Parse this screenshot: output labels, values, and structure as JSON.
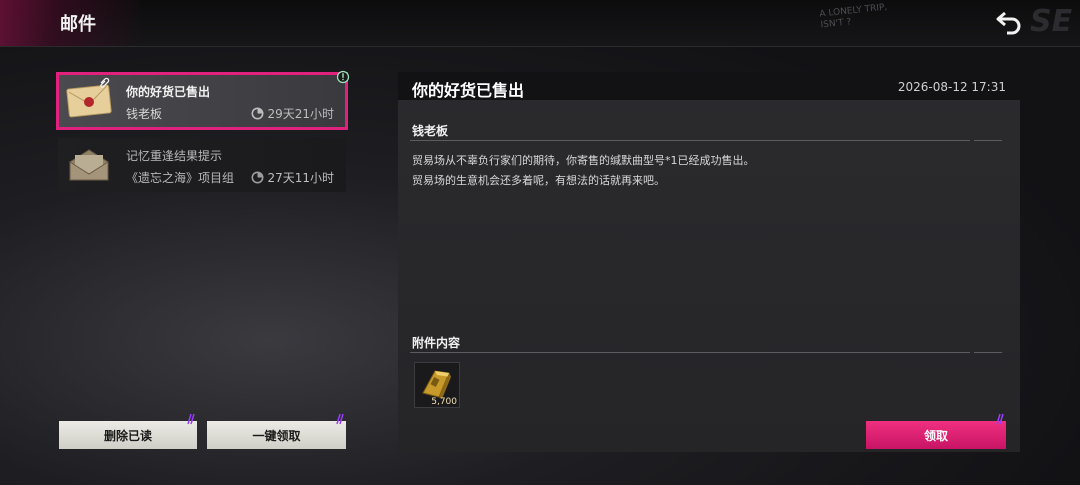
{
  "header": {
    "title": "邮件",
    "back_icon": "back-arrow-icon",
    "decor_text_1": "A LONELY TRIP,",
    "decor_text_2": "ISN'T ?",
    "decor_big": "SE"
  },
  "mail_list": [
    {
      "subject": "你的好货已售出",
      "sender": "钱老板",
      "expires": "29天21小时",
      "selected": true,
      "has_attachment": true,
      "is_new": true
    },
    {
      "subject": "记忆重逢结果提示",
      "sender": "《遗忘之海》项目组",
      "expires": "27天11小时",
      "selected": false,
      "has_attachment": false,
      "is_new": false
    }
  ],
  "actions": {
    "delete_read": "删除已读",
    "claim_all": "一键领取",
    "claim": "领取"
  },
  "detail": {
    "title": "你的好货已售出",
    "timestamp": "2026-08-12 17:31",
    "sender": "钱老板",
    "body": [
      "贸易场从不辜负行家们的期待，你寄售的缄默曲型号*1已经成功售出。",
      "贸易场的生意机会还多着呢，有想法的话就再来吧。"
    ],
    "attachments_label": "附件内容",
    "attachments": [
      {
        "icon": "gold-bar-icon",
        "quantity": "5,700"
      }
    ]
  },
  "colors": {
    "accent": "#e0217e",
    "claim_button": "#e3256f",
    "light_button": "#e3e2dc"
  }
}
